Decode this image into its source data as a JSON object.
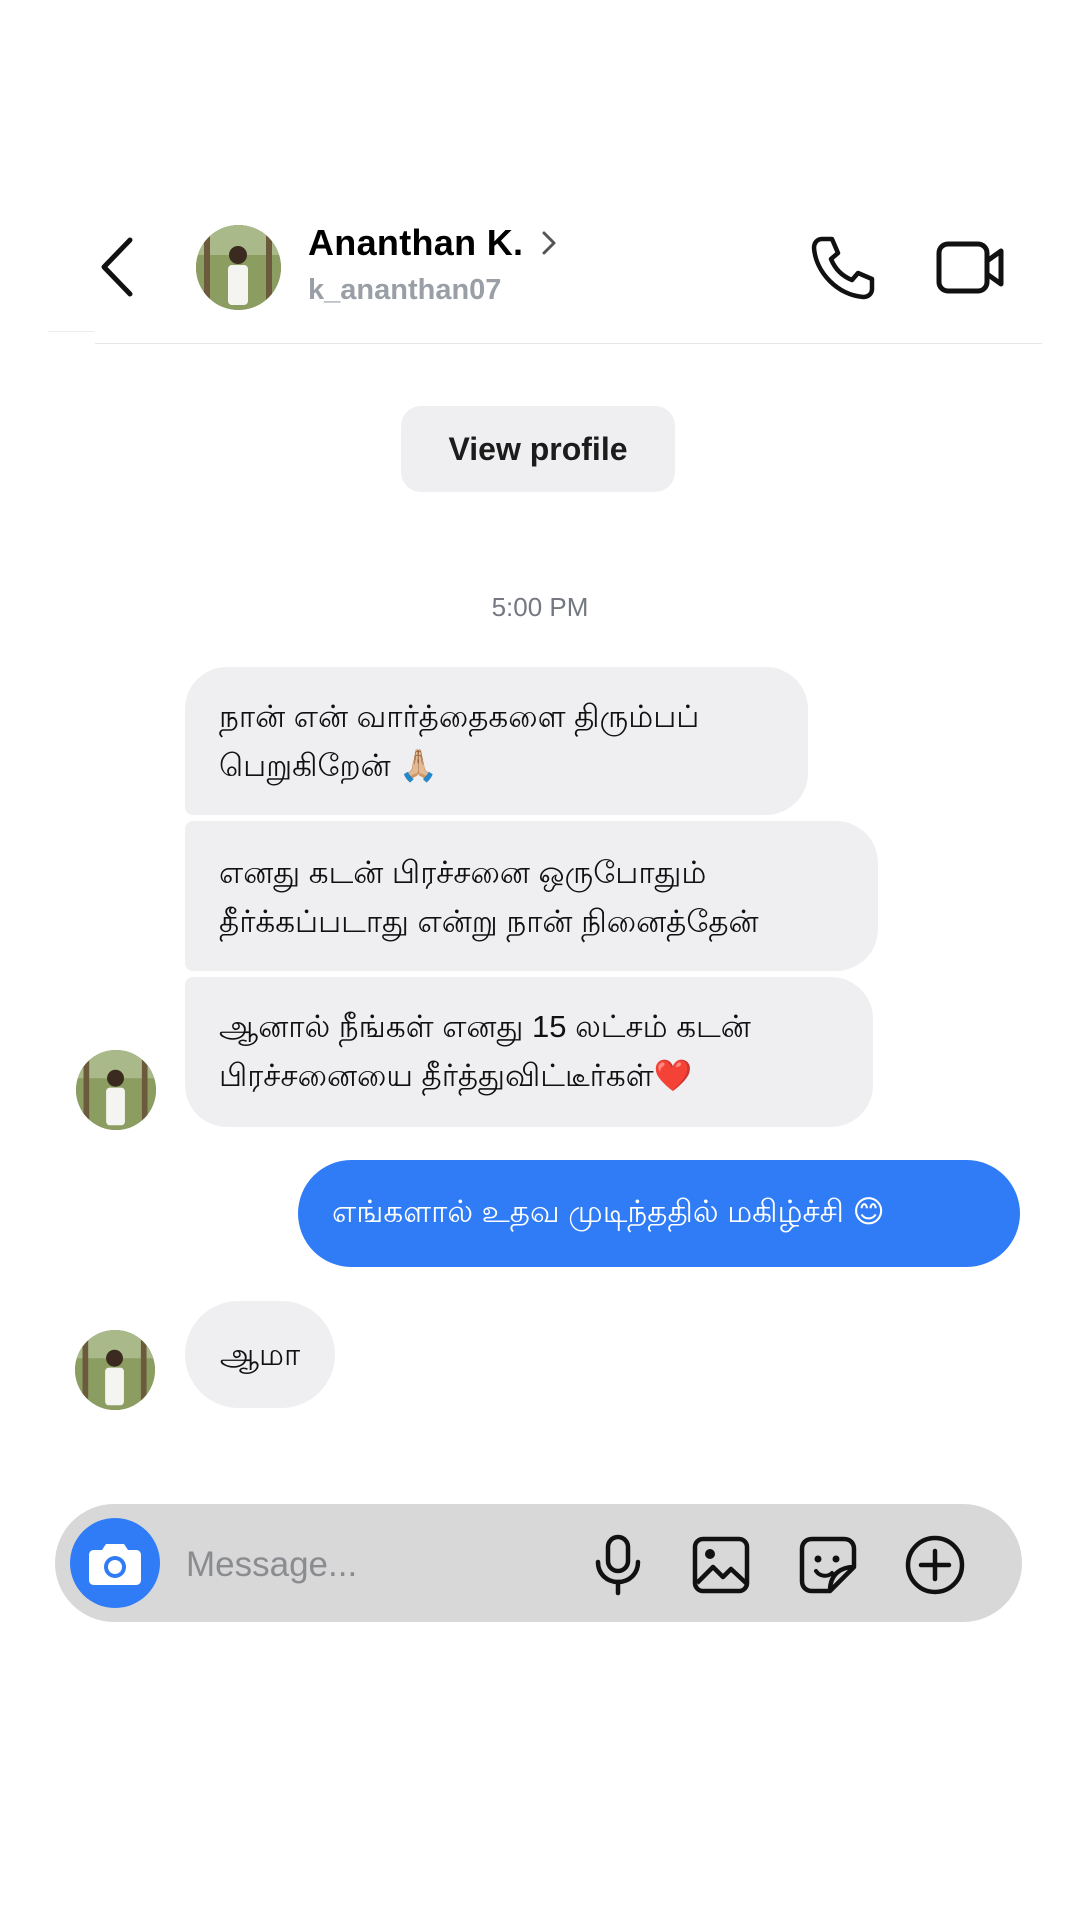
{
  "header": {
    "back_icon": "chevron-left-icon",
    "name": "Ananthan K.",
    "username": "k_ananthan07",
    "name_chevron": "chevron-right-icon",
    "call_icon": "phone-icon",
    "video_icon": "video-camera-icon"
  },
  "view_profile_label": "View profile",
  "timestamp": "5:00 PM",
  "messages": [
    {
      "from": "them",
      "lines": [
        "நான் என் வார்த்தைகளை திரும்பப்",
        "பெறுகிறேன் 🙏🏼"
      ]
    },
    {
      "from": "them",
      "lines": [
        "எனது கடன் பிரச்சனை ஒருபோதும்",
        "தீர்க்கப்படாது என்று நான் நினைத்தேன்"
      ]
    },
    {
      "from": "them",
      "lines": [
        "ஆனால் நீங்கள் எனது 15 லட்சம் கடன்",
        "பிரச்சனையை தீர்த்துவிட்டீர்கள்❤️"
      ]
    },
    {
      "from": "me",
      "text": "எங்களால் உதவ முடிந்ததில் மகிழ்ச்சி 😊"
    },
    {
      "from": "them",
      "text": "ஆமா"
    }
  ],
  "composer": {
    "placeholder": "Message...",
    "camera_icon": "camera-icon",
    "mic_icon": "microphone-icon",
    "gallery_icon": "image-icon",
    "sticker_icon": "sticker-icon",
    "plus_icon": "plus-circle-icon"
  },
  "colors": {
    "accent": "#2f7cf6",
    "bubble_received": "#efeff1",
    "composer_bg": "#d8d8d8",
    "muted_text": "#9a9ea6"
  }
}
